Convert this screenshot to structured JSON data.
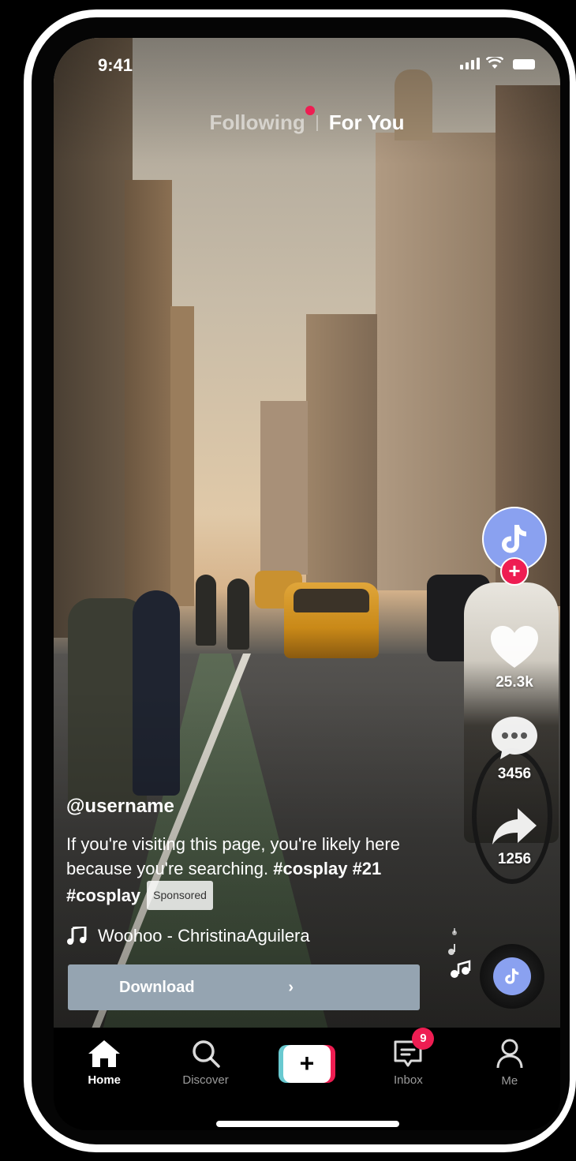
{
  "status": {
    "time": "9:41"
  },
  "tabs": {
    "following": "Following",
    "for_you": "For You"
  },
  "rail": {
    "likes": "25.3k",
    "comments": "3456",
    "shares": "1256"
  },
  "post": {
    "username": "@username",
    "description_text": "If you're visiting this page, you're likely here because you're searching.",
    "hashtag_1": "#cosplay",
    "hashtag_2": "#21",
    "hashtag_3": "#cosplay",
    "sponsored_label": "Sponsored",
    "music": "Woohoo - ChristinaAguilera"
  },
  "cta": {
    "download_label": "Download",
    "arrow": "›"
  },
  "nav": {
    "home": "Home",
    "discover": "Discover",
    "create": "+",
    "inbox": "Inbox",
    "inbox_badge": "9",
    "me": "Me"
  },
  "colors": {
    "accent_red": "#ee1d52",
    "accent_cyan": "#69c9d0",
    "avatar_bg": "#8aa1f0",
    "download_bg": "#95a4b1"
  }
}
